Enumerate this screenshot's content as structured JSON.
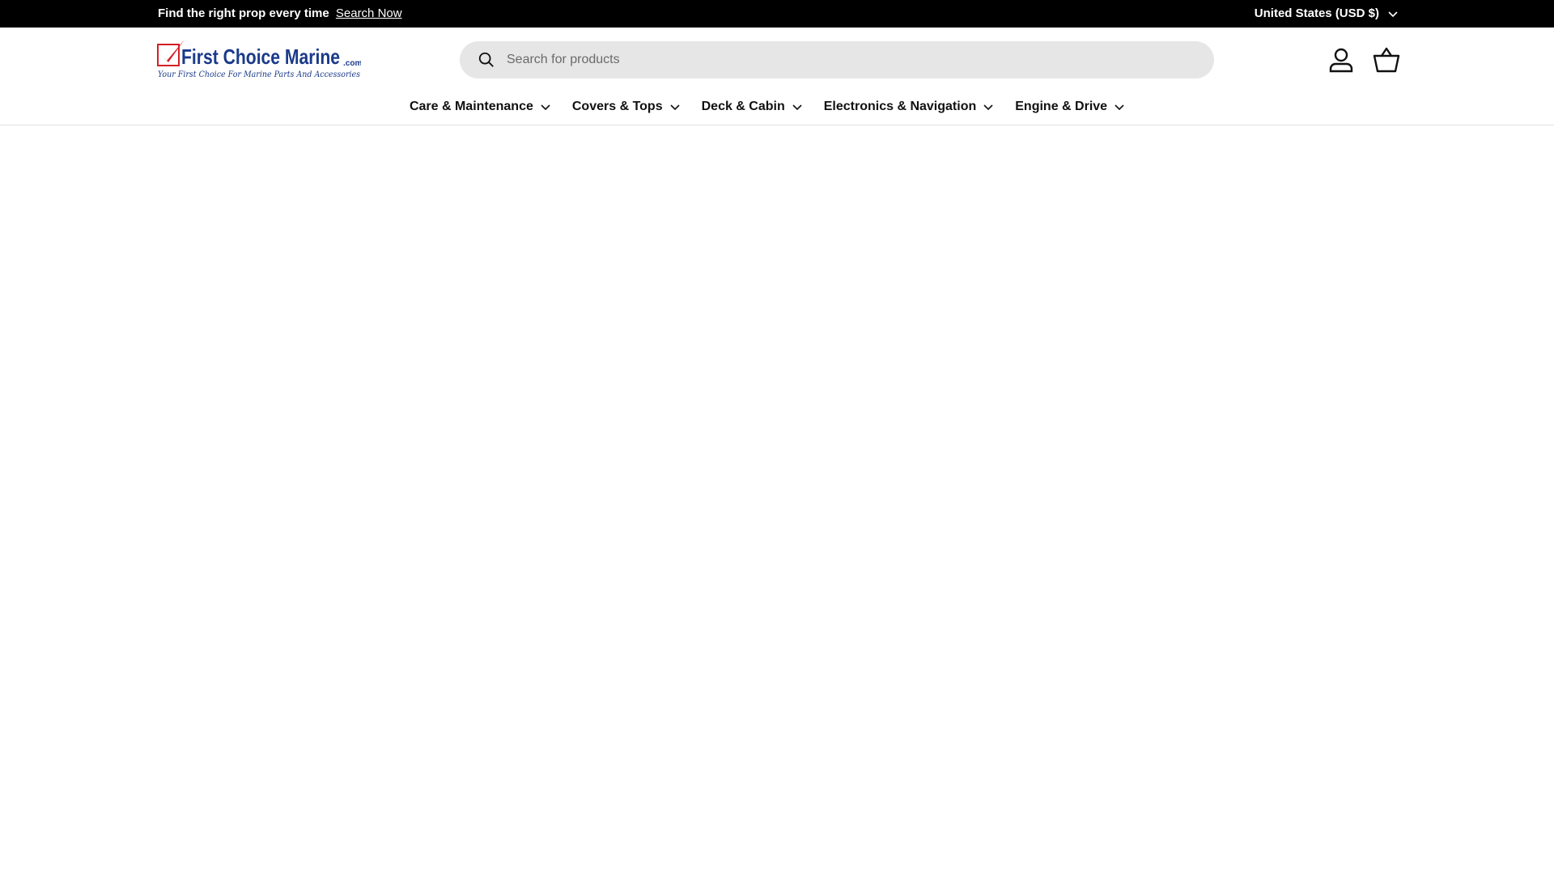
{
  "announcement": {
    "message": "Find the right prop every time",
    "link_label": "Search Now",
    "country_selector": "United States (USD $)"
  },
  "header": {
    "logo": {
      "name": "First Choice Marine",
      "suffix": ".com",
      "tagline": "Your First Choice For Marine Parts And Accessories",
      "colors": {
        "check": "#d42027",
        "text": "#1a3a8a"
      }
    },
    "search": {
      "placeholder": "Search for products",
      "value": ""
    },
    "icons": {
      "account": "account-icon",
      "cart": "cart-icon"
    }
  },
  "nav": {
    "items": [
      {
        "label": "Care & Maintenance"
      },
      {
        "label": "Covers & Tops"
      },
      {
        "label": "Deck & Cabin"
      },
      {
        "label": "Electronics & Navigation"
      },
      {
        "label": "Engine & Drive"
      }
    ]
  }
}
